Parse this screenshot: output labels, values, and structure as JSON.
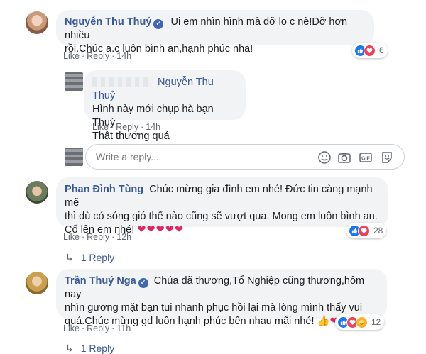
{
  "comments": [
    {
      "author": "Nguyễn Thu Thuỷ",
      "text_line1": "Ui em nhìn hình mà đỡ lo c nè!Đỡ hơn nhiều",
      "text_line2": "rồi.Chúc a.c luôn bình an,hạnh phúc nha!",
      "like": "Like",
      "reply": "Reply",
      "time": "14h",
      "reaction_count": "6"
    },
    {
      "author": "Phan Đình Tùng",
      "text_line1": "Chúc mừng gia đình em nhé! Đức tin càng mạnh mẽ",
      "text_line2": "thì dù có sóng gió thế nào cũng sẽ vượt qua. Mong em luôn bình an.",
      "text_line3": "Cố lên em nhé!",
      "hearts": "❤❤❤❤❤",
      "like": "Like",
      "reply": "Reply",
      "time": "12h",
      "reaction_count": "28",
      "replies_label": "1 Reply"
    },
    {
      "author": "Trần Thuý Nga",
      "text_line1": "Chúa đã thương,Tổ Nghiệp cũng thương,hôm nay",
      "text_line2": "nhìn gương mặt bạn tui nhanh phục hồi lại mà lòng mình thấy vui",
      "text_line3": "quá.Chúc mừng gd luôn hạnh phúc bên nhau mãi nhé!",
      "emojis": "👍❤😘",
      "like": "Like",
      "reply": "Reply",
      "time": "11h",
      "reaction_count": "12",
      "replies_label": "1 Reply"
    }
  ],
  "reply": {
    "mention": "Nguyễn Thu Thuỷ",
    "text_line1": "Hình này mới chụp hà bạn Thuý",
    "text_line2": "Thật thương quá",
    "like": "Like",
    "reply": "Reply",
    "time": "14h"
  },
  "composer": {
    "placeholder": "Write a reply..."
  },
  "icons": {
    "verified": "verified-badge-icon",
    "like": "like-reaction-icon",
    "love": "love-reaction-icon",
    "care": "care-reaction-icon",
    "emoji": "emoji-icon",
    "camera": "camera-icon",
    "gif": "gif-icon",
    "sticker": "sticker-icon",
    "reply_arrow": "reply-arrow-icon"
  },
  "colors": {
    "link": "#385898",
    "bubble": "#f2f3f5",
    "like": "#1877f2",
    "love": "#f33e58"
  }
}
